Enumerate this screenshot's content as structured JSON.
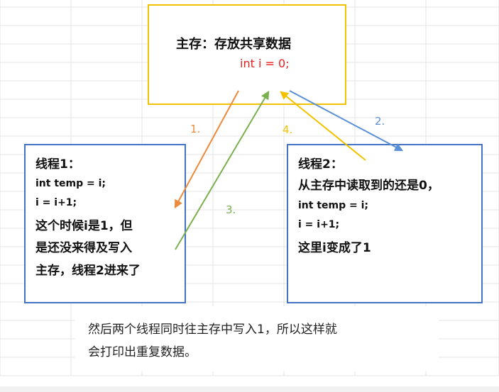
{
  "main_memory": {
    "title": "主存：存放共享数据",
    "code": "int i = 0;",
    "color": "#f2c200"
  },
  "thread1": {
    "title": "线程1：",
    "lines": [
      "int temp = i;",
      "i = i+1;",
      "这个时候i是1，但",
      "是还没来得及写入",
      "主存，线程2进来了"
    ],
    "color": "#4472c4"
  },
  "thread2": {
    "title": "线程2：",
    "lines": [
      "从主存中读取到的还是0，",
      "int temp = i;",
      "i = i+1;",
      "这里i变成了1"
    ],
    "color": "#4472c4"
  },
  "steps": {
    "step1": {
      "label": "1.",
      "color": "#ed8a3c"
    },
    "step2": {
      "label": "2.",
      "color": "#5b8fd6"
    },
    "step3": {
      "label": "3.",
      "color": "#7bb04f"
    },
    "step4": {
      "label": "4.",
      "color": "#f2c200"
    }
  },
  "summary": {
    "lines": [
      "然后两个线程同时往主存中写入1，所以这样就",
      "会打印出重复数据。"
    ]
  }
}
